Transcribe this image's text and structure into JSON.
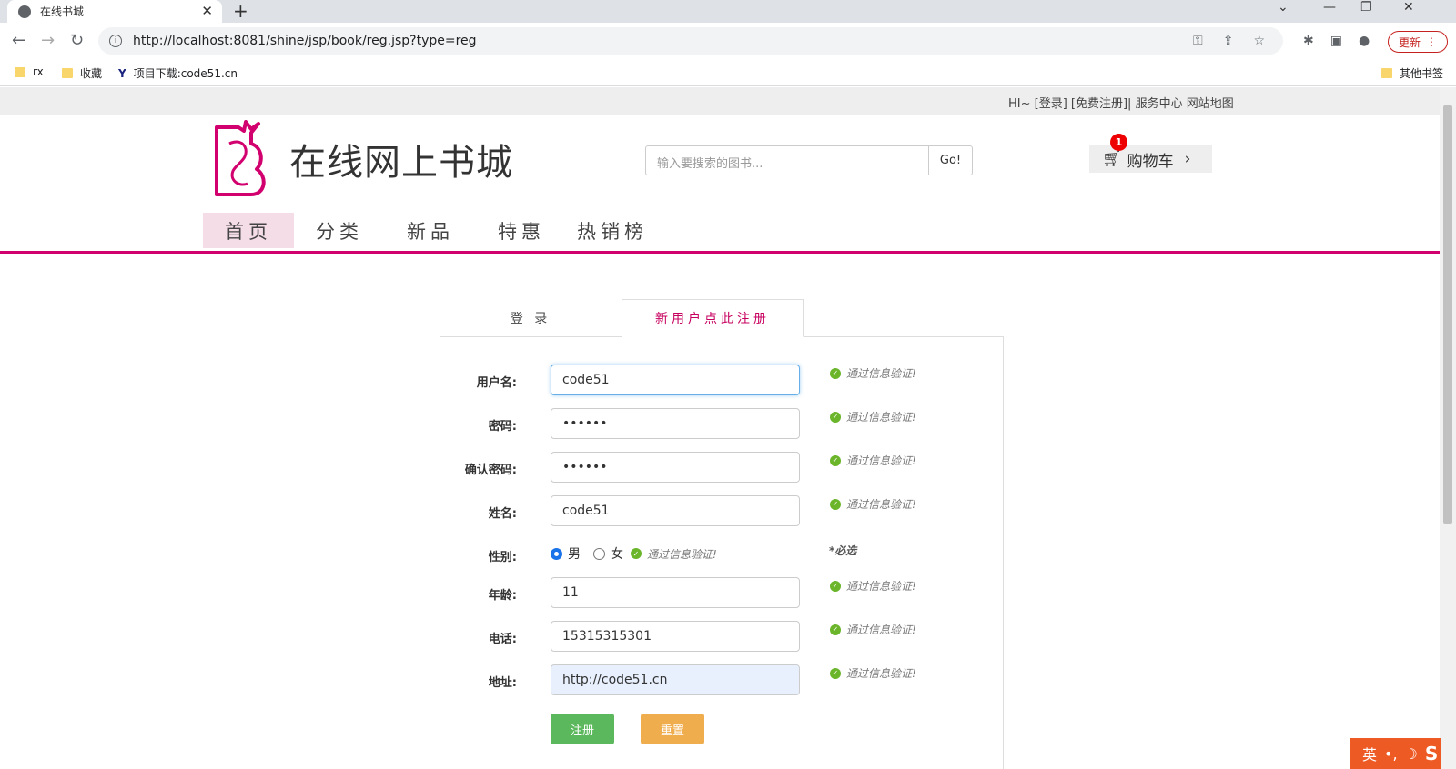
{
  "browser": {
    "tab_title": "在线书城",
    "url": "http://localhost:8081/shine/jsp/book/reg.jsp?type=reg",
    "update_label": "更新",
    "bookmarks": [
      "rx",
      "收藏",
      "项目下载:code51.cn"
    ],
    "other_bookmarks": "其他书签"
  },
  "header": {
    "top_links": "HI~ [登录] [免费注册]| 服务中心 网站地图",
    "site_title": "在线网上书城",
    "search_placeholder": "输入要搜索的图书...",
    "search_button": "Go!",
    "cart_label": "购物车",
    "cart_count": "1"
  },
  "nav": {
    "items": [
      "首页",
      "分类",
      "新品",
      "特惠",
      "热销榜"
    ]
  },
  "form": {
    "tabs": [
      "登 录",
      "新用户点此注册"
    ],
    "ok_text": "通过信息验证!",
    "required_text": "*必选",
    "fields": {
      "username": {
        "label": "用户名:",
        "value": "code51"
      },
      "password": {
        "label": "密码:",
        "value": "••••••"
      },
      "confirm": {
        "label": "确认密码:",
        "value": "••••••"
      },
      "name": {
        "label": "姓名:",
        "value": "code51"
      },
      "gender": {
        "label": "性别:",
        "male": "男",
        "female": "女"
      },
      "age": {
        "label": "年龄:",
        "value": "11"
      },
      "phone": {
        "label": "电话:",
        "value": "15315315301"
      },
      "address": {
        "label": "地址:",
        "value": "http://code51.cn"
      }
    },
    "submit": "注册",
    "reset": "重置"
  },
  "ime": {
    "label": "英"
  },
  "colors": {
    "accent": "#d2006e",
    "submit": "#5cb85c",
    "reset": "#f0ad4e"
  }
}
